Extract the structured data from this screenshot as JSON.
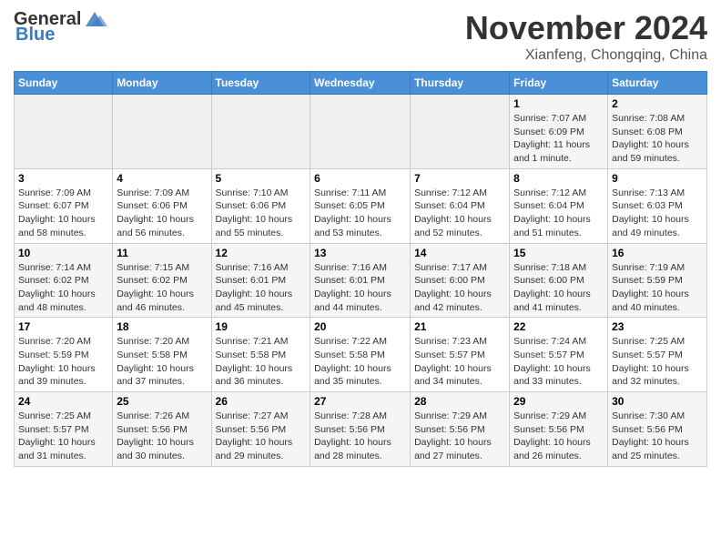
{
  "header": {
    "logo_general": "General",
    "logo_blue": "Blue",
    "month_title": "November 2024",
    "location": "Xianfeng, Chongqing, China"
  },
  "weekdays": [
    "Sunday",
    "Monday",
    "Tuesday",
    "Wednesday",
    "Thursday",
    "Friday",
    "Saturday"
  ],
  "weeks": [
    [
      {
        "day": "",
        "info": ""
      },
      {
        "day": "",
        "info": ""
      },
      {
        "day": "",
        "info": ""
      },
      {
        "day": "",
        "info": ""
      },
      {
        "day": "",
        "info": ""
      },
      {
        "day": "1",
        "info": "Sunrise: 7:07 AM\nSunset: 6:09 PM\nDaylight: 11 hours and 1 minute."
      },
      {
        "day": "2",
        "info": "Sunrise: 7:08 AM\nSunset: 6:08 PM\nDaylight: 10 hours and 59 minutes."
      }
    ],
    [
      {
        "day": "3",
        "info": "Sunrise: 7:09 AM\nSunset: 6:07 PM\nDaylight: 10 hours and 58 minutes."
      },
      {
        "day": "4",
        "info": "Sunrise: 7:09 AM\nSunset: 6:06 PM\nDaylight: 10 hours and 56 minutes."
      },
      {
        "day": "5",
        "info": "Sunrise: 7:10 AM\nSunset: 6:06 PM\nDaylight: 10 hours and 55 minutes."
      },
      {
        "day": "6",
        "info": "Sunrise: 7:11 AM\nSunset: 6:05 PM\nDaylight: 10 hours and 53 minutes."
      },
      {
        "day": "7",
        "info": "Sunrise: 7:12 AM\nSunset: 6:04 PM\nDaylight: 10 hours and 52 minutes."
      },
      {
        "day": "8",
        "info": "Sunrise: 7:12 AM\nSunset: 6:04 PM\nDaylight: 10 hours and 51 minutes."
      },
      {
        "day": "9",
        "info": "Sunrise: 7:13 AM\nSunset: 6:03 PM\nDaylight: 10 hours and 49 minutes."
      }
    ],
    [
      {
        "day": "10",
        "info": "Sunrise: 7:14 AM\nSunset: 6:02 PM\nDaylight: 10 hours and 48 minutes."
      },
      {
        "day": "11",
        "info": "Sunrise: 7:15 AM\nSunset: 6:02 PM\nDaylight: 10 hours and 46 minutes."
      },
      {
        "day": "12",
        "info": "Sunrise: 7:16 AM\nSunset: 6:01 PM\nDaylight: 10 hours and 45 minutes."
      },
      {
        "day": "13",
        "info": "Sunrise: 7:16 AM\nSunset: 6:01 PM\nDaylight: 10 hours and 44 minutes."
      },
      {
        "day": "14",
        "info": "Sunrise: 7:17 AM\nSunset: 6:00 PM\nDaylight: 10 hours and 42 minutes."
      },
      {
        "day": "15",
        "info": "Sunrise: 7:18 AM\nSunset: 6:00 PM\nDaylight: 10 hours and 41 minutes."
      },
      {
        "day": "16",
        "info": "Sunrise: 7:19 AM\nSunset: 5:59 PM\nDaylight: 10 hours and 40 minutes."
      }
    ],
    [
      {
        "day": "17",
        "info": "Sunrise: 7:20 AM\nSunset: 5:59 PM\nDaylight: 10 hours and 39 minutes."
      },
      {
        "day": "18",
        "info": "Sunrise: 7:20 AM\nSunset: 5:58 PM\nDaylight: 10 hours and 37 minutes."
      },
      {
        "day": "19",
        "info": "Sunrise: 7:21 AM\nSunset: 5:58 PM\nDaylight: 10 hours and 36 minutes."
      },
      {
        "day": "20",
        "info": "Sunrise: 7:22 AM\nSunset: 5:58 PM\nDaylight: 10 hours and 35 minutes."
      },
      {
        "day": "21",
        "info": "Sunrise: 7:23 AM\nSunset: 5:57 PM\nDaylight: 10 hours and 34 minutes."
      },
      {
        "day": "22",
        "info": "Sunrise: 7:24 AM\nSunset: 5:57 PM\nDaylight: 10 hours and 33 minutes."
      },
      {
        "day": "23",
        "info": "Sunrise: 7:25 AM\nSunset: 5:57 PM\nDaylight: 10 hours and 32 minutes."
      }
    ],
    [
      {
        "day": "24",
        "info": "Sunrise: 7:25 AM\nSunset: 5:57 PM\nDaylight: 10 hours and 31 minutes."
      },
      {
        "day": "25",
        "info": "Sunrise: 7:26 AM\nSunset: 5:56 PM\nDaylight: 10 hours and 30 minutes."
      },
      {
        "day": "26",
        "info": "Sunrise: 7:27 AM\nSunset: 5:56 PM\nDaylight: 10 hours and 29 minutes."
      },
      {
        "day": "27",
        "info": "Sunrise: 7:28 AM\nSunset: 5:56 PM\nDaylight: 10 hours and 28 minutes."
      },
      {
        "day": "28",
        "info": "Sunrise: 7:29 AM\nSunset: 5:56 PM\nDaylight: 10 hours and 27 minutes."
      },
      {
        "day": "29",
        "info": "Sunrise: 7:29 AM\nSunset: 5:56 PM\nDaylight: 10 hours and 26 minutes."
      },
      {
        "day": "30",
        "info": "Sunrise: 7:30 AM\nSunset: 5:56 PM\nDaylight: 10 hours and 25 minutes."
      }
    ]
  ]
}
